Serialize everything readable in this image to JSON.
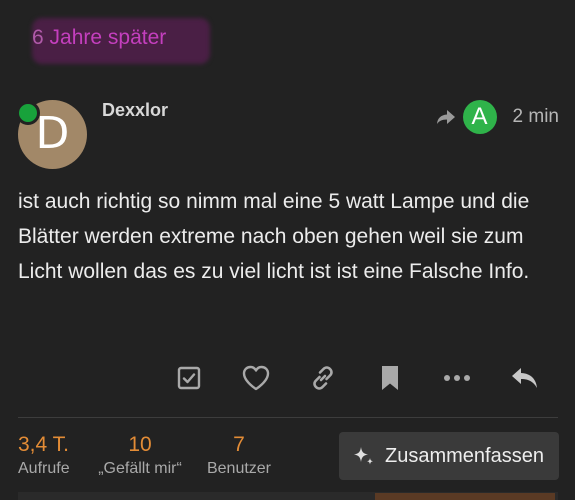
{
  "gap": {
    "number": "6",
    "text": " Jahre später"
  },
  "post": {
    "avatar_letter": "D",
    "username": "Dexxlor",
    "reply_to_avatar_letter": "A",
    "time": "2 min",
    "body": "ist auch richtig so nimm mal eine 5 watt Lampe und die Blätter werden extreme nach oben gehen weil sie zum Licht wollen das es zu viel licht ist ist eine Falsche Info."
  },
  "actions": [
    {
      "name": "solution-checkbox-icon"
    },
    {
      "name": "like-heart-icon"
    },
    {
      "name": "share-link-icon"
    },
    {
      "name": "bookmark-icon"
    },
    {
      "name": "more-dots-icon"
    },
    {
      "name": "reply-icon"
    }
  ],
  "stats": {
    "views": {
      "value": "3,4 T.",
      "label": "Aufrufe"
    },
    "likes": {
      "value": "10",
      "label": "„Gefällt mir“"
    },
    "users": {
      "value": "7",
      "label": "Benutzer"
    }
  },
  "summarize_button": {
    "label": "Zusammenfassen"
  },
  "colors": {
    "background": "#222222",
    "gap_text": "#c43fbe",
    "stat_number": "#e38c36",
    "online": "#18a23b",
    "reply_avatar": "#2fb34a",
    "user_avatar": "#a28868"
  }
}
